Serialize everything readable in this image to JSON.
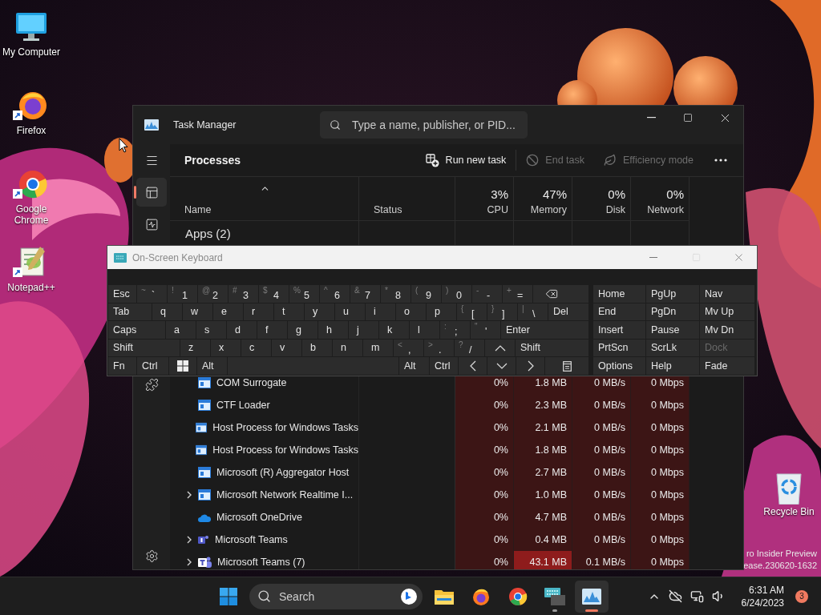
{
  "desktop_icons": [
    {
      "label": "My Computer",
      "kind": "computer",
      "shortcut": false
    },
    {
      "label": "Firefox",
      "kind": "firefox",
      "shortcut": true
    },
    {
      "label": "Google Chrome",
      "kind": "chrome",
      "shortcut": true
    },
    {
      "label": "Notepad++",
      "kind": "notepad",
      "shortcut": true
    }
  ],
  "recycle_bin": {
    "label": "Recycle Bin"
  },
  "watermark": [
    "ro Insider Preview",
    "ease.230620-1632"
  ],
  "task_manager": {
    "title": "Task Manager",
    "search": {
      "placeholder": "Type a name, publisher, or PID..."
    },
    "nav": [
      {
        "kind": "menu",
        "selected": false
      },
      {
        "kind": "processes",
        "selected": true
      },
      {
        "kind": "performance",
        "selected": false
      },
      {
        "kind": "services",
        "selected": false
      },
      {
        "kind": "settings",
        "selected": false
      }
    ],
    "page_title": "Processes",
    "toolbar": [
      {
        "kind": "run",
        "label": "Run new task",
        "disabled": false
      },
      {
        "kind": "end",
        "label": "End task",
        "disabled": true
      },
      {
        "kind": "efficiency",
        "label": "Efficiency mode",
        "disabled": true
      }
    ],
    "columns": [
      {
        "label": "Name",
        "sorted": true
      },
      {
        "label": "Status",
        "sorted": false
      },
      {
        "usage": "3%",
        "label": "CPU",
        "sorted": false
      },
      {
        "usage": "47%",
        "label": "Memory",
        "sorted": false
      },
      {
        "usage": "0%",
        "label": "Disk",
        "sorted": false
      },
      {
        "usage": "0%",
        "label": "Network",
        "sorted": false
      }
    ],
    "group": "Apps (2)",
    "rows": [
      {
        "name": "COM Surrogate",
        "kind": "window",
        "expandable": false,
        "cpu": "0%",
        "memory": "1.8 MB",
        "disk": "0 MB/s",
        "network": "0 Mbps",
        "memory_hot": false
      },
      {
        "name": "CTF Loader",
        "kind": "window",
        "expandable": false,
        "cpu": "0%",
        "memory": "2.3 MB",
        "disk": "0 MB/s",
        "network": "0 Mbps",
        "memory_hot": false
      },
      {
        "name": "Host Process for Windows Tasks",
        "kind": "window",
        "expandable": false,
        "cpu": "0%",
        "memory": "2.1 MB",
        "disk": "0 MB/s",
        "network": "0 Mbps",
        "memory_hot": false
      },
      {
        "name": "Host Process for Windows Tasks",
        "kind": "window",
        "expandable": false,
        "cpu": "0%",
        "memory": "1.8 MB",
        "disk": "0 MB/s",
        "network": "0 Mbps",
        "memory_hot": false
      },
      {
        "name": "Microsoft (R) Aggregator Host",
        "kind": "window",
        "expandable": false,
        "cpu": "0%",
        "memory": "2.7 MB",
        "disk": "0 MB/s",
        "network": "0 Mbps",
        "memory_hot": false
      },
      {
        "name": "Microsoft Network Realtime I...",
        "kind": "window",
        "expandable": true,
        "cpu": "0%",
        "memory": "1.0 MB",
        "disk": "0 MB/s",
        "network": "0 Mbps",
        "memory_hot": false
      },
      {
        "name": "Microsoft OneDrive",
        "kind": "cloud",
        "expandable": false,
        "cpu": "0%",
        "memory": "4.7 MB",
        "disk": "0 MB/s",
        "network": "0 Mbps",
        "memory_hot": false
      },
      {
        "name": "Microsoft Teams",
        "kind": "people-small",
        "expandable": true,
        "cpu": "0%",
        "memory": "0.4 MB",
        "disk": "0 MB/s",
        "network": "0 Mbps",
        "memory_hot": false
      },
      {
        "name": "Microsoft Teams (7)",
        "kind": "people",
        "expandable": true,
        "cpu": "0%",
        "memory": "43.1 MB",
        "disk": "0.1 MB/s",
        "network": "0 Mbps",
        "memory_hot": true
      }
    ]
  },
  "keyboard": {
    "title": "On-Screen Keyboard",
    "rows": [
      [
        {
          "kind": "text",
          "label": "Esc"
        },
        {
          "kind": "char",
          "shift": "~",
          "label": "`"
        },
        {
          "kind": "char",
          "shift": "!",
          "label": "1"
        },
        {
          "kind": "char",
          "shift": "@",
          "label": "2"
        },
        {
          "kind": "char",
          "shift": "#",
          "label": "3"
        },
        {
          "kind": "char",
          "shift": "$",
          "label": "4"
        },
        {
          "kind": "char",
          "shift": "%",
          "label": "5"
        },
        {
          "kind": "char",
          "shift": "^",
          "label": "6"
        },
        {
          "kind": "char",
          "shift": "&",
          "label": "7"
        },
        {
          "kind": "char",
          "shift": "*",
          "label": "8"
        },
        {
          "kind": "char",
          "shift": "(",
          "label": "9"
        },
        {
          "kind": "char",
          "shift": ")",
          "label": "0"
        },
        {
          "kind": "char",
          "shift": "-",
          "label": "-"
        },
        {
          "kind": "char",
          "shift": "+",
          "label": "="
        },
        {
          "kind": "backspace"
        }
      ],
      [
        {
          "kind": "text",
          "label": "Tab"
        },
        {
          "kind": "char",
          "label": "q"
        },
        {
          "kind": "char",
          "label": "w"
        },
        {
          "kind": "char",
          "label": "e"
        },
        {
          "kind": "char",
          "label": "r"
        },
        {
          "kind": "char",
          "label": "t"
        },
        {
          "kind": "char",
          "label": "y"
        },
        {
          "kind": "char",
          "label": "u"
        },
        {
          "kind": "char",
          "label": "i"
        },
        {
          "kind": "char",
          "label": "o"
        },
        {
          "kind": "char",
          "label": "p"
        },
        {
          "kind": "char",
          "shift": "{",
          "label": "["
        },
        {
          "kind": "char",
          "shift": "}",
          "label": "]"
        },
        {
          "kind": "char",
          "shift": "|",
          "label": "\\"
        },
        {
          "kind": "text",
          "label": "Del"
        }
      ],
      [
        {
          "kind": "text",
          "label": "Caps"
        },
        {
          "kind": "char",
          "label": "a"
        },
        {
          "kind": "char",
          "label": "s"
        },
        {
          "kind": "char",
          "label": "d"
        },
        {
          "kind": "char",
          "label": "f"
        },
        {
          "kind": "char",
          "label": "g"
        },
        {
          "kind": "char",
          "label": "h"
        },
        {
          "kind": "char",
          "label": "j"
        },
        {
          "kind": "char",
          "label": "k"
        },
        {
          "kind": "char",
          "label": "l"
        },
        {
          "kind": "char",
          "shift": ":",
          "label": ";"
        },
        {
          "kind": "char",
          "shift": "\"",
          "label": "'"
        },
        {
          "kind": "text",
          "label": "Enter"
        }
      ],
      [
        {
          "kind": "text",
          "label": "Shift"
        },
        {
          "kind": "char",
          "label": "z"
        },
        {
          "kind": "char",
          "label": "x"
        },
        {
          "kind": "char",
          "label": "c"
        },
        {
          "kind": "char",
          "label": "v"
        },
        {
          "kind": "char",
          "label": "b"
        },
        {
          "kind": "char",
          "label": "n"
        },
        {
          "kind": "char",
          "label": "m"
        },
        {
          "kind": "char",
          "shift": "<",
          "label": ","
        },
        {
          "kind": "char",
          "shift": ">",
          "label": "."
        },
        {
          "kind": "char",
          "shift": "?",
          "label": "/"
        },
        {
          "kind": "up"
        },
        {
          "kind": "text",
          "label": "Shift"
        }
      ],
      [
        {
          "kind": "text",
          "label": "Fn"
        },
        {
          "kind": "text",
          "label": "Ctrl"
        },
        {
          "kind": "windows"
        },
        {
          "kind": "text",
          "label": "Alt"
        },
        {
          "kind": "space"
        },
        {
          "kind": "text",
          "label": "Alt"
        },
        {
          "kind": "text",
          "label": "Ctrl"
        },
        {
          "kind": "left"
        },
        {
          "kind": "down"
        },
        {
          "kind": "right"
        },
        {
          "kind": "menu"
        }
      ]
    ],
    "nav": [
      [
        {
          "label": "Home",
          "disabled": false
        },
        {
          "label": "PgUp",
          "disabled": false
        },
        {
          "label": "Nav",
          "disabled": false
        }
      ],
      [
        {
          "label": "End",
          "disabled": false
        },
        {
          "label": "PgDn",
          "disabled": false
        },
        {
          "label": "Mv Up",
          "disabled": false
        }
      ],
      [
        {
          "label": "Insert",
          "disabled": false
        },
        {
          "label": "Pause",
          "disabled": false
        },
        {
          "label": "Mv Dn",
          "disabled": false
        }
      ],
      [
        {
          "label": "PrtScn",
          "disabled": false
        },
        {
          "label": "ScrLk",
          "disabled": false
        },
        {
          "label": "Dock",
          "disabled": true
        }
      ],
      [
        {
          "label": "Options",
          "disabled": false
        },
        {
          "label": "Help",
          "disabled": false
        },
        {
          "label": "Fade",
          "disabled": false
        }
      ]
    ]
  },
  "taskbar": {
    "search": {
      "placeholder": "Search"
    },
    "apps": [
      {
        "kind": "explorer",
        "running": false,
        "active": false
      },
      {
        "kind": "firefox",
        "running": false,
        "active": false
      },
      {
        "kind": "chrome",
        "running": false,
        "active": false
      },
      {
        "kind": "keyboard",
        "running": true,
        "active": false
      },
      {
        "kind": "taskmanager",
        "running": true,
        "active": true
      }
    ],
    "time": "6:31 AM",
    "date": "6/24/2023",
    "notifications": "3"
  }
}
